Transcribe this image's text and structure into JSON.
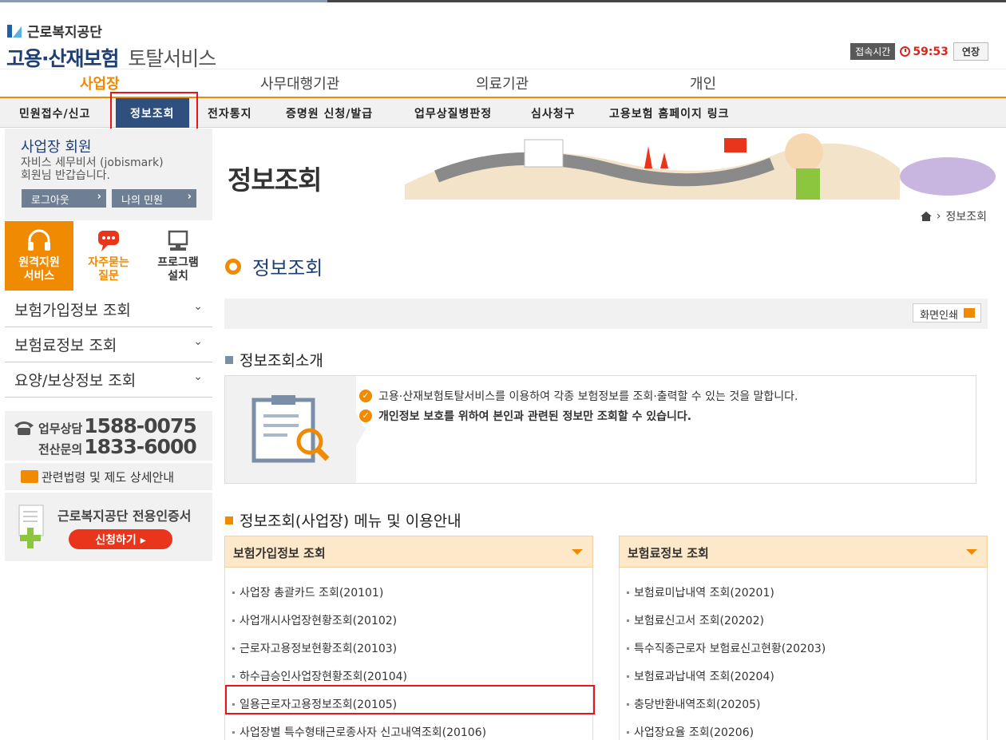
{
  "header": {
    "org_name": "근로복지공단",
    "service_title": "고용·산재보험",
    "service_subtitle": "토탈서비스",
    "session_label": "접속시간",
    "session_time": "59:53",
    "extend_label": "연장"
  },
  "main_nav": [
    "사업장",
    "사무대행기관",
    "의료기관",
    "개인"
  ],
  "sub_nav": [
    "민원접수/신고",
    "정보조회",
    "전자통지",
    "증명원 신청/발급",
    "업무상질병판정",
    "심사청구",
    "고용보험 홈페이지 링크"
  ],
  "member": {
    "title": "사업장 회원",
    "line1": "자비스 세무비서 (jobismark)",
    "line2": "회원님 반갑습니다.",
    "logout": "로그아웃",
    "my_civil": "나의 민원"
  },
  "quick": {
    "remote": [
      "원격지원",
      "서비스"
    ],
    "faq": [
      "자주묻는",
      "질문"
    ],
    "program": [
      "프로그램",
      "설치"
    ]
  },
  "left_menu": [
    "보험가입정보 조회",
    "보험료정보 조회",
    "요양/보상정보 조회"
  ],
  "contact": {
    "work_label": "업무상담",
    "work_number": "1588-0075",
    "it_label": "전산문의",
    "it_number": "1833-6000",
    "law_link": "관련법령 및 제도 상세안내",
    "cert_title": "근로복지공단 전용인증서",
    "cert_button": "신청하기"
  },
  "banner": {
    "title": "정보조회"
  },
  "breadcrumb": {
    "current": "정보조회"
  },
  "page": {
    "title": "정보조회",
    "print": "화면인쇄",
    "intro_title": "정보조회소개",
    "intro_line1": "고용·산재보험토탈서비스를 이용하여 각종 보험정보를 조회·출력할 수 있는 것을 말합니다.",
    "intro_line2": "개인정보 보호를 위하여 본인과 관련된 정보만 조회할 수 있습니다.",
    "menu_title": "정보조회(사업장) 메뉴 및 이용안내"
  },
  "menus": {
    "insurance": {
      "title": "보험가입정보 조회",
      "items": [
        "사업장 총괄카드 조회(20101)",
        "사업개시사업장현황조회(20102)",
        "근로자고용정보현황조회(20103)",
        "하수급승인사업장현황조회(20104)",
        "일용근로자고용정보조회(20105)",
        "사업장별 특수형태근로종사자 신고내역조회(20106)"
      ]
    },
    "premium": {
      "title": "보험료정보 조회",
      "items": [
        "보험료미납내역 조회(20201)",
        "보험료신고서 조회(20202)",
        "특수직종근로자 보험료신고현황(20203)",
        "보험료과납내역 조회(20204)",
        "충당반환내역조회(20205)",
        "사업장요율 조회(20206)"
      ]
    }
  }
}
